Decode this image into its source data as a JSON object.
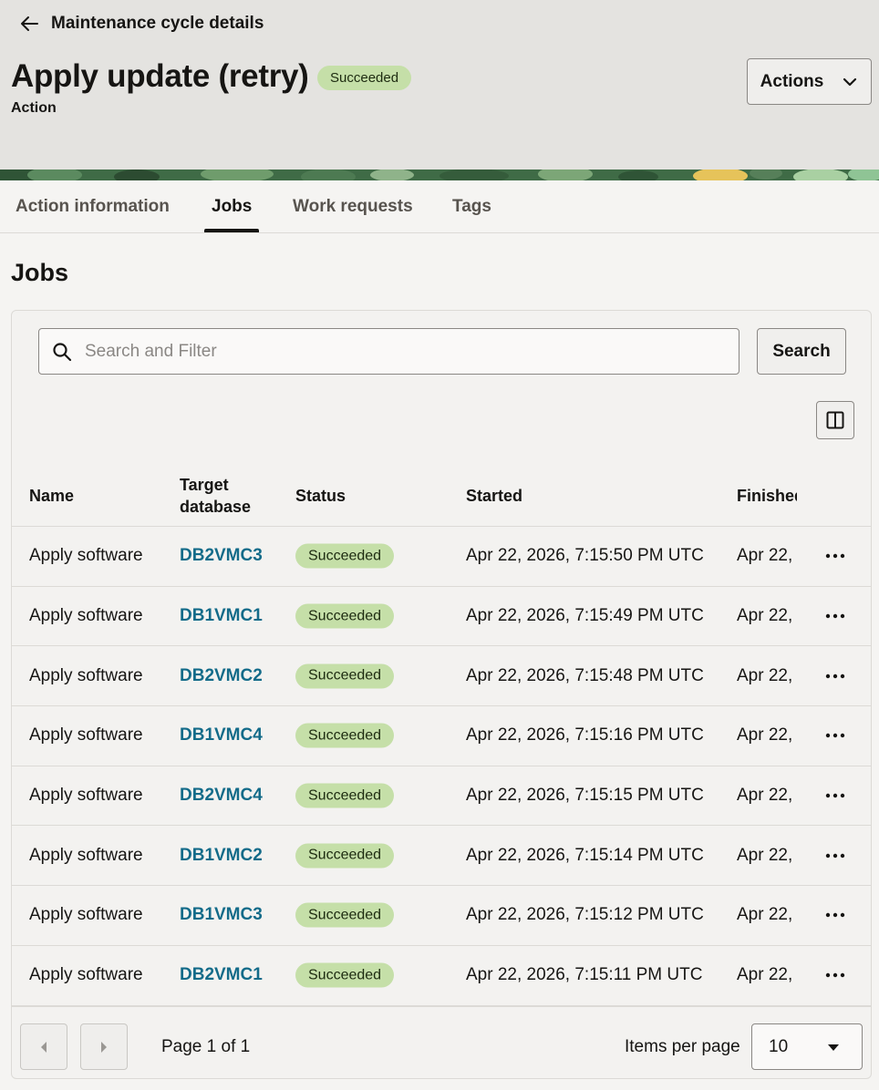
{
  "header": {
    "back_label": "Maintenance cycle details",
    "title": "Apply update (retry)",
    "status_badge": "Succeeded",
    "subtitle": "Action",
    "actions_label": "Actions"
  },
  "tabs": [
    {
      "label": "Action information",
      "active": false
    },
    {
      "label": "Jobs",
      "active": true
    },
    {
      "label": "Work requests",
      "active": false
    },
    {
      "label": "Tags",
      "active": false
    }
  ],
  "section_title": "Jobs",
  "search": {
    "placeholder": "Search and Filter",
    "value": "",
    "button_label": "Search"
  },
  "table": {
    "columns": [
      "Name",
      "Target\ndatabase",
      "Status",
      "Started",
      "Finished"
    ],
    "rows": [
      {
        "name": "Apply software",
        "target_database": "DB2VMC3",
        "status": "Succeeded",
        "started": "Apr 22, 2026, 7:15:50 PM UTC",
        "finished": "Apr 22,"
      },
      {
        "name": "Apply software",
        "target_database": "DB1VMC1",
        "status": "Succeeded",
        "started": "Apr 22, 2026, 7:15:49 PM UTC",
        "finished": "Apr 22,"
      },
      {
        "name": "Apply software",
        "target_database": "DB2VMC2",
        "status": "Succeeded",
        "started": "Apr 22, 2026, 7:15:48 PM UTC",
        "finished": "Apr 22,"
      },
      {
        "name": "Apply software",
        "target_database": "DB1VMC4",
        "status": "Succeeded",
        "started": "Apr 22, 2026, 7:15:16 PM UTC",
        "finished": "Apr 22,"
      },
      {
        "name": "Apply software",
        "target_database": "DB2VMC4",
        "status": "Succeeded",
        "started": "Apr 22, 2026, 7:15:15 PM UTC",
        "finished": "Apr 22,"
      },
      {
        "name": "Apply software",
        "target_database": "DB1VMC2",
        "status": "Succeeded",
        "started": "Apr 22, 2026, 7:15:14 PM UTC",
        "finished": "Apr 22,"
      },
      {
        "name": "Apply software",
        "target_database": "DB1VMC3",
        "status": "Succeeded",
        "started": "Apr 22, 2026, 7:15:12 PM UTC",
        "finished": "Apr 22,"
      },
      {
        "name": "Apply software",
        "target_database": "DB2VMC1",
        "status": "Succeeded",
        "started": "Apr 22, 2026, 7:15:11 PM UTC",
        "finished": "Apr 22,"
      }
    ]
  },
  "pagination": {
    "page_info": "Page 1 of 1",
    "items_per_page_label": "Items per page",
    "items_per_page_value": "10"
  },
  "colors": {
    "link": "#136b89",
    "success_badge": "#c5dfa8",
    "header_bg": "#e4e3e0"
  },
  "icons": {
    "back": "arrow-left-icon",
    "actions": "chevron-down-icon",
    "search": "search-icon",
    "columns": "columns-icon",
    "row_menu": "more-horizontal-icon",
    "prev": "chevron-left-icon",
    "next": "chevron-right-icon",
    "select": "caret-down-icon"
  }
}
